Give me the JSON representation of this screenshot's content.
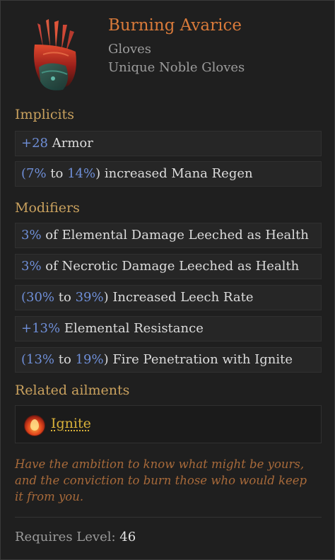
{
  "item": {
    "name": "Burning Avarice",
    "slot": "Gloves",
    "base": "Unique Noble Gloves",
    "icon": "gloves-icon"
  },
  "implicits": {
    "title": "Implicits",
    "rows": [
      {
        "parts": [
          "+28",
          " Armor"
        ]
      },
      {
        "parts": [
          "(",
          "7%",
          " to ",
          "14%",
          ") increased Mana Regen"
        ]
      }
    ]
  },
  "modifiers": {
    "title": "Modifiers",
    "rows": [
      {
        "parts": [
          "3%",
          " of Elemental Damage Leeched as Health"
        ]
      },
      {
        "parts": [
          "3%",
          " of Necrotic Damage Leeched as Health"
        ]
      },
      {
        "parts": [
          "(",
          "30%",
          " to ",
          "39%",
          ") Increased Leech Rate"
        ]
      },
      {
        "parts": [
          "+13%",
          " Elemental Resistance"
        ]
      },
      {
        "parts": [
          "(",
          "13%",
          " to ",
          "19%",
          ") Fire Penetration with Ignite"
        ]
      }
    ]
  },
  "ailments": {
    "title": "Related ailments",
    "items": [
      {
        "label": "Ignite",
        "icon": "ignite-icon"
      }
    ]
  },
  "flavor": {
    "lines": [
      "Have the ambition to know what might be yours,",
      "and the conviction to burn those who would keep",
      "it from you."
    ]
  },
  "requirements": {
    "label": "Requires Level:",
    "level": "46"
  },
  "colors": {
    "title": "#d97a3a",
    "section": "#c9a15e",
    "value_blue": "#6f8fd8",
    "flavor": "#a86a3a",
    "ailment_link": "#d9b23a"
  }
}
